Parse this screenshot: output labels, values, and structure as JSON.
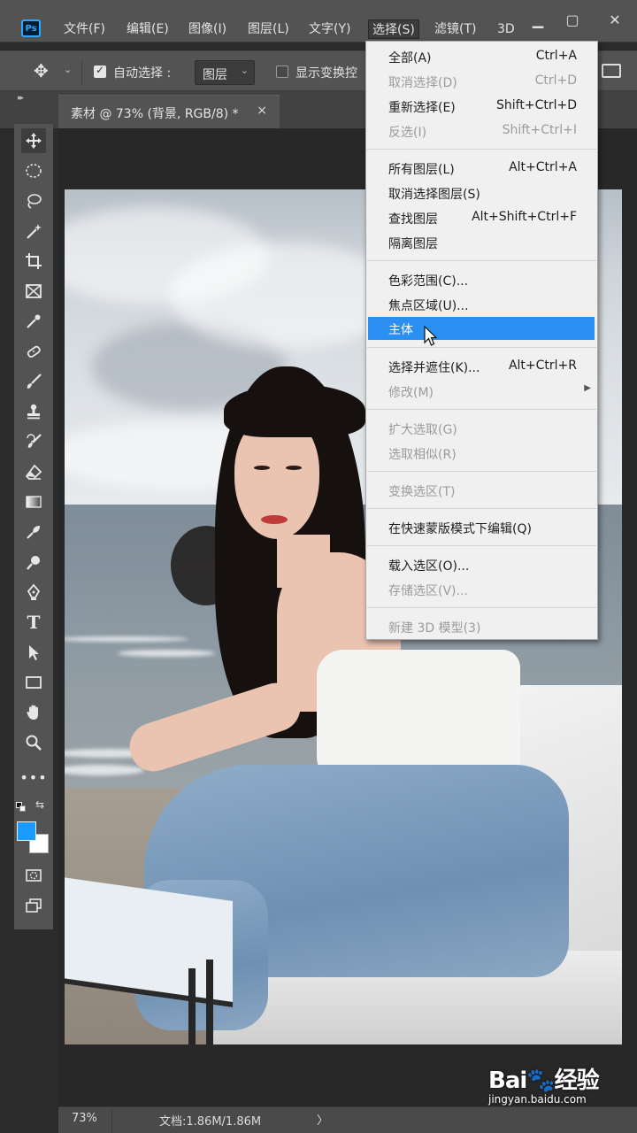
{
  "app": {
    "logo_text": "Ps",
    "menu": [
      "文件(F)",
      "编辑(E)",
      "图像(I)",
      "图层(L)",
      "文字(Y)",
      "选择(S)",
      "滤镜(T)",
      "3D"
    ],
    "active_menu": "选择(S)",
    "window_controls": [
      "minimize-icon",
      "maximize-icon",
      "close-icon"
    ]
  },
  "options_bar": {
    "auto_select_label": "自动选择 :",
    "auto_select_checked": true,
    "layer_select_value": "图层",
    "show_transform_label": "显示变换控",
    "show_transform_checked": false
  },
  "document_tab": {
    "title": "素材 @ 73% (背景, RGB/8) *",
    "close": "×"
  },
  "tools": [
    "move-tool-icon",
    "marquee-tool-icon",
    "lasso-tool-icon",
    "magic-wand-tool-icon",
    "crop-tool-icon",
    "frame-tool-icon",
    "eyedropper-tool-icon",
    "healing-brush-tool-icon",
    "brush-tool-icon",
    "clone-stamp-tool-icon",
    "history-brush-tool-icon",
    "eraser-tool-icon",
    "gradient-tool-icon",
    "blur-tool-icon",
    "dodge-tool-icon",
    "pen-tool-icon",
    "type-tool-icon",
    "path-selection-tool-icon",
    "rectangle-tool-icon",
    "hand-tool-icon",
    "zoom-tool-icon",
    "more-tools-icon",
    "quick-mask-icon",
    "screen-mode-icon"
  ],
  "colors": {
    "foreground": "#1a9bff",
    "background": "#ffffff",
    "highlight": "#2a8ff0"
  },
  "select_menu": {
    "groups": [
      [
        {
          "label": "全部(A)",
          "shortcut": "Ctrl+A",
          "disabled": false
        },
        {
          "label": "取消选择(D)",
          "shortcut": "Ctrl+D",
          "disabled": true
        },
        {
          "label": "重新选择(E)",
          "shortcut": "Shift+Ctrl+D",
          "disabled": false
        },
        {
          "label": "反选(I)",
          "shortcut": "Shift+Ctrl+I",
          "disabled": true
        }
      ],
      [
        {
          "label": "所有图层(L)",
          "shortcut": "Alt+Ctrl+A",
          "disabled": false
        },
        {
          "label": "取消选择图层(S)",
          "shortcut": "",
          "disabled": false
        },
        {
          "label": "查找图层",
          "shortcut": "Alt+Shift+Ctrl+F",
          "disabled": false
        },
        {
          "label": "隔离图层",
          "shortcut": "",
          "disabled": false
        }
      ],
      [
        {
          "label": "色彩范围(C)...",
          "shortcut": "",
          "disabled": false
        },
        {
          "label": "焦点区域(U)...",
          "shortcut": "",
          "disabled": false
        },
        {
          "label": "主体",
          "shortcut": "",
          "disabled": false,
          "highlighted": true
        }
      ],
      [
        {
          "label": "选择并遮住(K)...",
          "shortcut": "Alt+Ctrl+R",
          "disabled": false
        },
        {
          "label": "修改(M)",
          "shortcut": "",
          "disabled": true,
          "submenu": true
        }
      ],
      [
        {
          "label": "扩大选取(G)",
          "shortcut": "",
          "disabled": true
        },
        {
          "label": "选取相似(R)",
          "shortcut": "",
          "disabled": true
        }
      ],
      [
        {
          "label": "变换选区(T)",
          "shortcut": "",
          "disabled": true
        }
      ],
      [
        {
          "label": "在快速蒙版模式下编辑(Q)",
          "shortcut": "",
          "disabled": false
        }
      ],
      [
        {
          "label": "载入选区(O)...",
          "shortcut": "",
          "disabled": false
        },
        {
          "label": "存储选区(V)...",
          "shortcut": "",
          "disabled": true
        }
      ],
      [
        {
          "label": "新建 3D 模型(3)",
          "shortcut": "",
          "disabled": true
        }
      ]
    ]
  },
  "status_bar": {
    "zoom": "73%",
    "doc_info": "文档:1.86M/1.86M",
    "arrow": "〉"
  },
  "watermark": {
    "logo": "Bai🐾经验",
    "url": "jingyan.baidu.com"
  }
}
